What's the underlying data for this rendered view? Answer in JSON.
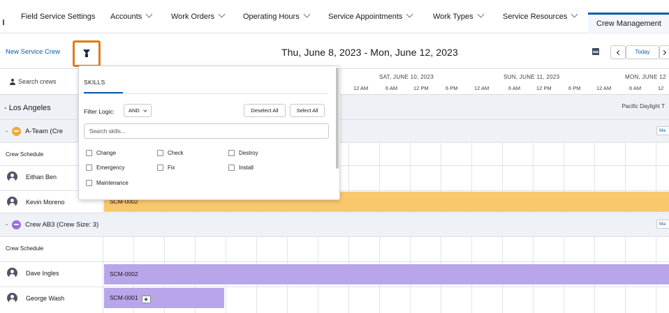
{
  "tabs": [
    {
      "label": "Field Service Settings",
      "dropdown": false
    },
    {
      "label": "Accounts",
      "dropdown": true
    },
    {
      "label": "Work Orders",
      "dropdown": true
    },
    {
      "label": "Operating Hours",
      "dropdown": true
    },
    {
      "label": "Service Appointments",
      "dropdown": true
    },
    {
      "label": "Work Types",
      "dropdown": true
    },
    {
      "label": "Service Resources",
      "dropdown": true
    }
  ],
  "active_tab": "Crew Management",
  "toolbar": {
    "new_crew_label": "New Service Crew",
    "filter_icon": "filter-icon",
    "date_range": "Thu, June 8, 2023 - Mon, June 12, 2023",
    "calendar_icon": "calendar-icon",
    "today_label": "Today"
  },
  "search_label": "Search crews",
  "timeline": {
    "days": [
      "SAT, JUNE 10, 2023",
      "SUN, JUNE 11, 2023",
      "MON, JUNE 12"
    ],
    "hours": [
      "12 AM",
      "6 AM",
      "12 PM",
      "6 PM",
      "12 AM",
      "6 AM",
      "12 PM",
      "6 PM",
      "12 AM",
      "6 AM",
      "12"
    ]
  },
  "region": {
    "name": "Los Angeles",
    "timezone": "Pacific Daylight T"
  },
  "crews": [
    {
      "title": "A-Team (Cre",
      "color": "orange",
      "ma": "Ma",
      "schedule_label": "Crew Schedule",
      "members": [
        {
          "name": "Eithan Ben",
          "bar": ""
        },
        {
          "name": "Kevin Moreno",
          "bar": "SCM-0002"
        }
      ]
    },
    {
      "title": "Crew AB3 (Crew Size: 3)",
      "color": "purple",
      "ma": "Ma",
      "schedule_label": "Crew Schedule",
      "members": [
        {
          "name": "Dave Ingles",
          "bar": "SCM-0002"
        },
        {
          "name": "George Wash",
          "bar": "SCM-0001"
        }
      ]
    }
  ],
  "colors": {
    "accent": "#0b5cab",
    "highlight": "#e07b1a",
    "orange_bar": "#f9c76c",
    "purple_bar": "#b9a5ea"
  },
  "popover": {
    "tab_label": "SKILLS",
    "filter_logic_label": "Filter Logic:",
    "filter_logic_value": "AND",
    "deselect_all": "Deselect All",
    "select_all": "Select All",
    "search_placeholder": "Search skills...",
    "skills": [
      "Change",
      "Check",
      "Destroy",
      "Emergency",
      "Fix",
      "Install",
      "Maintenance"
    ]
  }
}
